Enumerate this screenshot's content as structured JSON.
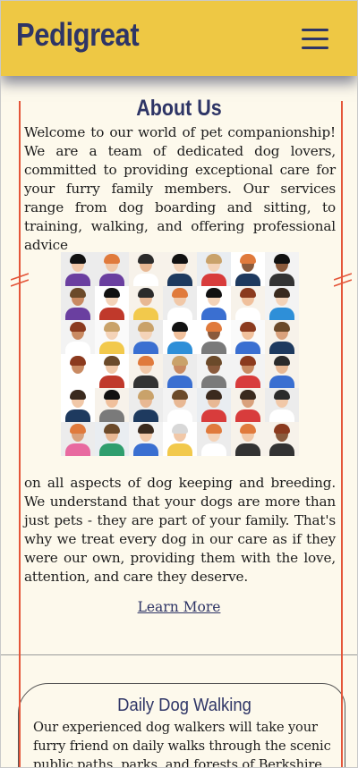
{
  "header": {
    "brand": "Pedigreat",
    "menu_icon": "hamburger-menu-icon"
  },
  "about": {
    "title": "About Us",
    "paragraph_1": "Welcome to our world of pet companionship! We are a team of dedicated dog lovers, committed to providing exceptional care for your furry family members. Our services range from dog boarding and sitting, to training, walking, and offering professional advice",
    "paragraph_2": "on all aspects of dog keeping and breeding. We understand that your dogs are more than just pets - they are part of your family. That's why we treat every dog in our care as if they were our own, providing them with the love, attention, and care they deserve.",
    "learn_more": "Learn More",
    "image": "team-faces-collage"
  },
  "service_card": {
    "title": "Daily Dog Walking",
    "text": "Our experienced dog walkers will take your furry friend on daily walks through the scenic public paths, parks, and forests of Berkshire."
  },
  "colors": {
    "header_bg": "#eec844",
    "brand": "#2e3566",
    "page_bg": "#fdf9ec",
    "accent_line": "#e4563a"
  }
}
